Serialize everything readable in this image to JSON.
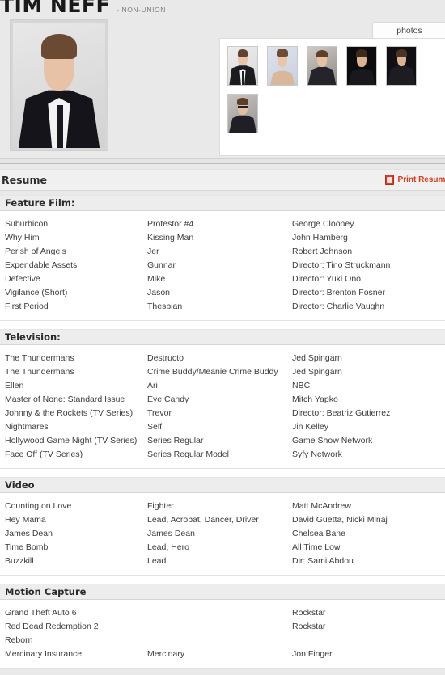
{
  "profile": {
    "name": "TIM NEFF",
    "union_status": "- NON-UNION"
  },
  "tabs": [
    {
      "label": "photos"
    }
  ],
  "gallery": {
    "thumbnail_count": 6
  },
  "resume_bar": {
    "title": "Resume",
    "print_label": "Print Resume",
    "print_icon": "pdf-icon",
    "accent_color": "#d93b1e"
  },
  "resume": {
    "sections": [
      {
        "title": "Feature Film:",
        "rows": [
          {
            "title": "Suburbicon",
            "role": "Protestor #4",
            "credit": "George Clooney"
          },
          {
            "title": "Why Him",
            "role": "Kissing Man",
            "credit": "John Hamberg"
          },
          {
            "title": "Perish of Angels",
            "role": "Jer",
            "credit": "Robert Johnson"
          },
          {
            "title": "Expendable Assets",
            "role": "Gunnar",
            "credit": "Director: Tino Struckmann"
          },
          {
            "title": "Defective",
            "role": "Mike",
            "credit": "Director: Yuki Ono"
          },
          {
            "title": "Vigilance (Short)",
            "role": "Jason",
            "credit": "Director: Brenton Fosner"
          },
          {
            "title": "First Period",
            "role": "Thesbian",
            "credit": "Director: Charlie Vaughn"
          }
        ]
      },
      {
        "title": "Television:",
        "rows": [
          {
            "title": "The Thundermans",
            "role": "Destructo",
            "credit": "Jed Spingarn"
          },
          {
            "title": "The Thundermans",
            "role": "Crime Buddy/Meanie Crime Buddy",
            "credit": "Jed Spingarn"
          },
          {
            "title": "Ellen",
            "role": "Ari",
            "credit": "NBC"
          },
          {
            "title": "Master of None: Standard Issue",
            "role": "Eye Candy",
            "credit": "Mitch Yapko"
          },
          {
            "title": "Johnny & the Rockets (TV Series)",
            "role": "Trevor",
            "credit": "Director: Beatriz Gutierrez"
          },
          {
            "title": "Nightmares",
            "role": "Self",
            "credit": "Jin Kelley"
          },
          {
            "title": "Hollywood Game Night (TV Series)",
            "role": "Series Regular",
            "credit": "Game Show Network"
          },
          {
            "title": "Face Off (TV Series)",
            "role": "Series Regular Model",
            "credit": "Syfy Network"
          }
        ]
      },
      {
        "title": "Video",
        "rows": [
          {
            "title": "Counting on Love",
            "role": "Fighter",
            "credit": "Matt McAndrew"
          },
          {
            "title": "Hey Mama",
            "role": "Lead, Acrobat, Dancer, Driver",
            "credit": "David Guetta, Nicki Minaj"
          },
          {
            "title": "James Dean",
            "role": "James Dean",
            "credit": "Chelsea Bane"
          },
          {
            "title": "Time Bomb",
            "role": "Lead, Hero",
            "credit": "All Time Low"
          },
          {
            "title": "Buzzkill",
            "role": "Lead",
            "credit": "Dir: Sami Abdou"
          }
        ]
      },
      {
        "title": "Motion Capture",
        "rows": [
          {
            "title": "Grand Theft Auto 6",
            "role": "",
            "credit": "Rockstar"
          },
          {
            "title": "Red Dead Redemption 2",
            "role": "",
            "credit": "Rockstar"
          },
          {
            "title": "Reborn",
            "role": "",
            "credit": ""
          },
          {
            "title": "Mercinary Insurance",
            "role": "Mercinary",
            "credit": "Jon Finger"
          }
        ]
      }
    ]
  }
}
